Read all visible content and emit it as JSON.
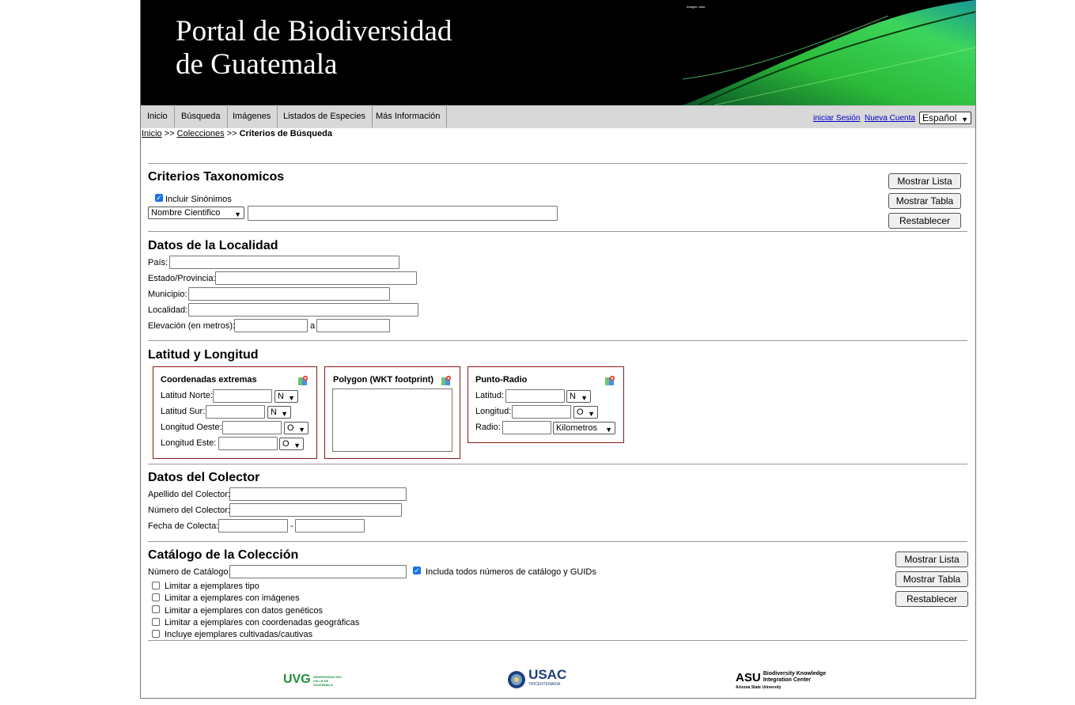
{
  "banner": {
    "title_line1": "Portal de Biodiversidad",
    "title_line2": "de Guatemala",
    "tiny_text": "Imágen: Aldo"
  },
  "nav": {
    "items": [
      "Inicio",
      "Búsqueda",
      "Imágenes",
      "Listados de Especies",
      "Más Información"
    ],
    "login": "iniciar Sesión",
    "new_account": "Nueva Cuenta",
    "language": "Español"
  },
  "breadcrumb": {
    "home": "Inicio",
    "sep1": ">>",
    "collections": "Colecciones",
    "sep2": ">>",
    "current": "Criterios de Búsqueda"
  },
  "buttons": {
    "show_list": "Mostrar Lista",
    "show_table": "Mostrar Tabla",
    "reset": "Restablecer"
  },
  "taxonomic": {
    "heading": "Criterios Taxonomicos",
    "include_synonyms": "Incluir Sinónimos",
    "include_synonyms_checked": true,
    "name_type": "Nombre Cientifico"
  },
  "locality": {
    "heading": "Datos de la Localidad",
    "country": "País:",
    "state": "Estado/Provincia:",
    "county": "Municipio:",
    "locality": "Localidad:",
    "elevation": "Elevación (en metros):",
    "elev_to": "a"
  },
  "latlong": {
    "heading": "Latitud y Longitud",
    "bbox": {
      "title": "Coordenadas extremas",
      "north": "Latitud Norte:",
      "south": "Latitud Sur:",
      "west": "Longitud Oeste:",
      "east": "Longitud Este:",
      "north_dir": "N",
      "south_dir": "N",
      "west_dir": "O",
      "east_dir": "O"
    },
    "polygon": {
      "title": "Polygon (WKT footprint)"
    },
    "point": {
      "title": "Punto-Radio",
      "lat": "Latitud:",
      "lng": "Longitud:",
      "radius": "Radio:",
      "lat_dir": "N",
      "lng_dir": "O",
      "units": "Kilometros"
    }
  },
  "collector": {
    "heading": "Datos del Colector",
    "last_name": "Apellido del Colector:",
    "number": "Número del Colector:",
    "date": "Fecha de Colecta:",
    "date_sep": "-"
  },
  "catalog": {
    "heading": "Catálogo de la Colección",
    "number": "Número de Catálogo:",
    "include_all": "Includa todos números de catálogo y GUIDs",
    "include_all_checked": true,
    "options": [
      "Limitar a ejemplares tipo",
      "Limitar a ejemplares con imágenes",
      "Limitar a ejemplares con datos genéticos",
      "Limitar a ejemplares con coordenadas geográficas",
      "Incluye ejemplares cultivadas/cautivas"
    ]
  },
  "footer": {
    "uvg": "UVG",
    "uvg_sub": "UNIVERSIDAD DEL VALLE DE GUATEMALA",
    "usac": "USAC",
    "usac_sub": "TRICENTENARIA",
    "asu": "ASU",
    "asu_sub1": "Biodiversity Knowledge",
    "asu_sub2": "Integration Center",
    "asu_sub3": "Arizona State University"
  },
  "colors": {
    "nav_bg": "#d8d8d8",
    "box_border": "#8b1a1a",
    "link": "#0000cc",
    "uvg_green": "#1f8f3a",
    "usac_blue": "#1d3f7a"
  }
}
